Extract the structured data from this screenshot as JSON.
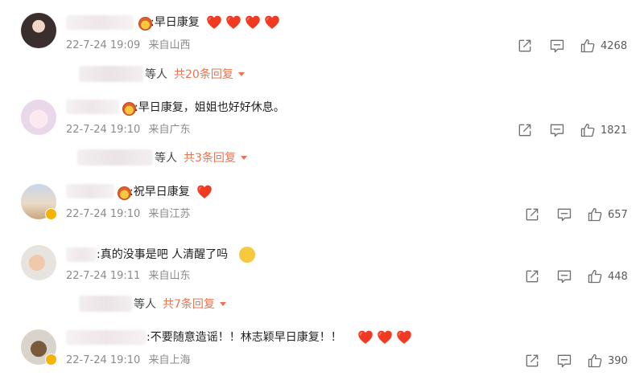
{
  "comments": [
    {
      "text": ":早日康复",
      "time": "22-7-24 19:09",
      "location": "来自山西",
      "likes": "4268",
      "replies": {
        "others": "等人",
        "link": "共20条回复"
      }
    },
    {
      "text": ":早日康复，姐姐也好好休息。",
      "time": "22-7-24 19:10",
      "location": "来自广东",
      "likes": "1821",
      "replies": {
        "others": "等人",
        "link": "共3条回复"
      }
    },
    {
      "text": ":祝早日康复",
      "time": "22-7-24 19:10",
      "location": "来自江苏",
      "likes": "657"
    },
    {
      "text": ":真的没事是吧 人清醒了吗",
      "time": "22-7-24 19:11",
      "location": "来自山东",
      "likes": "448",
      "replies": {
        "others": "等人",
        "link": "共7条回复"
      }
    },
    {
      "text": ":不要随意造谣！！林志颖早日康复！！",
      "time": "22-7-24 19:10",
      "location": "来自上海",
      "likes": "390"
    }
  ],
  "icons": {
    "share": "share-icon",
    "comment": "comment-icon",
    "like": "thumbs-up-icon",
    "heart": "red-heart-emoji",
    "crown": "crown-badge-icon",
    "verified": "verified-badge-icon"
  },
  "colors": {
    "accent": "#eb7350",
    "heart": "#f03b22",
    "meta": "#8a8a8a"
  }
}
